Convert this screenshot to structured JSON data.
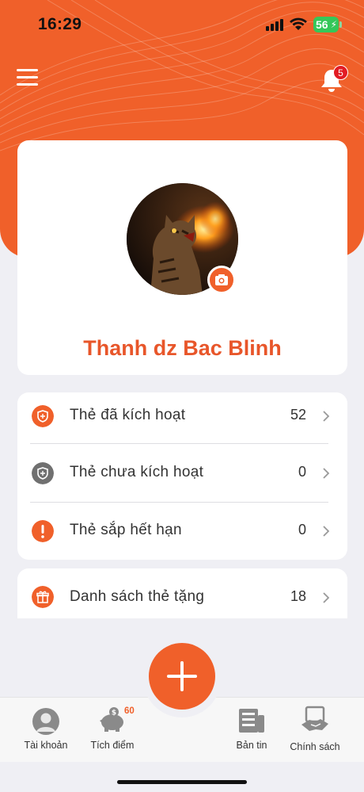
{
  "status_bar": {
    "time": "16:29",
    "battery": "56"
  },
  "header": {
    "notification_count": "5"
  },
  "profile": {
    "name": "Thanh dz Bac Blinh"
  },
  "card_list": [
    {
      "label": "Thẻ đã kích hoạt",
      "value": "52",
      "icon": "shield-icon",
      "color": "#f0602a"
    },
    {
      "label": "Thẻ chưa kích hoạt",
      "value": "0",
      "icon": "shield-icon",
      "color": "#707070"
    },
    {
      "label": "Thẻ sắp hết hạn",
      "value": "0",
      "icon": "alert-icon",
      "color": "#f0602a"
    }
  ],
  "gift_list": {
    "label": "Danh sách thẻ tặng",
    "value": "18",
    "icon": "gift-icon",
    "color": "#f0602a"
  },
  "tabbar": {
    "account": "Tài khoản",
    "points": "Tích điểm",
    "points_value": "60",
    "news": "Bản tin",
    "policy": "Chính sách"
  },
  "colors": {
    "accent": "#f0602a",
    "name": "#e8562a",
    "background": "#efeff4"
  }
}
